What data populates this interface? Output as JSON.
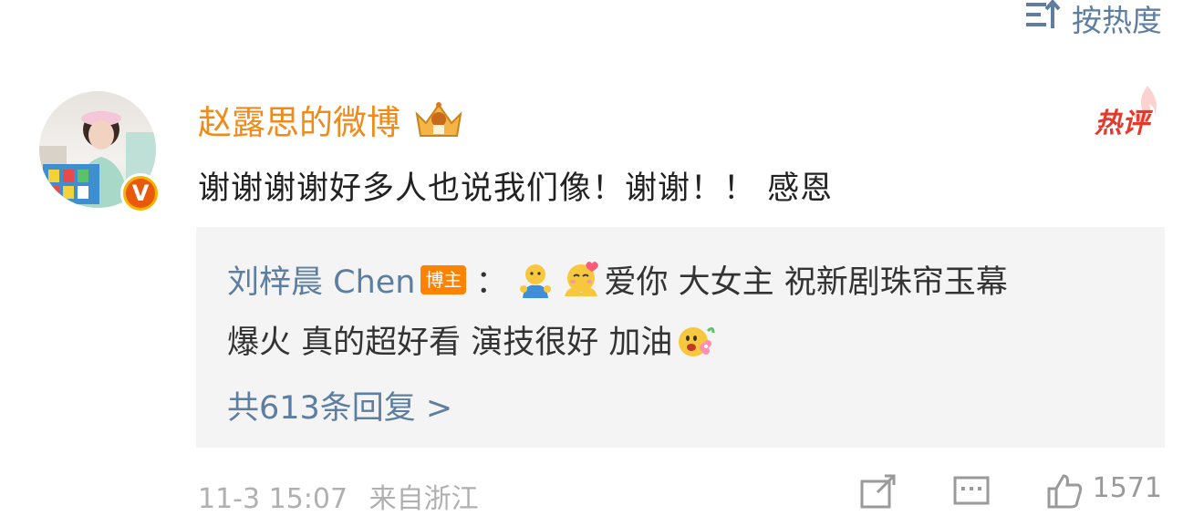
{
  "sort": {
    "label": "按热度",
    "icon": "sort-icon"
  },
  "comment": {
    "username": "赵露思的微博",
    "hot_label": "热评",
    "text": "谢谢谢谢好多人也说我们像！谢谢！！ 感恩",
    "time": "11-3 15:07",
    "location": "来自浙江",
    "like_count": "1571"
  },
  "reply": {
    "author": "刘梓晨 Chen",
    "role": "博主",
    "separator": "：",
    "text_line1": "爱你 大女主 祝新剧珠帘玉幕",
    "text_line2": "爆火 真的超好看 演技很好 加油",
    "more": "共613条回复 >"
  },
  "colors": {
    "link": "#5d7ea0",
    "username": "#f08a1a",
    "hot": "#e33a2b",
    "badge": "#ff8200",
    "reply_bg": "#f4f4f4"
  }
}
